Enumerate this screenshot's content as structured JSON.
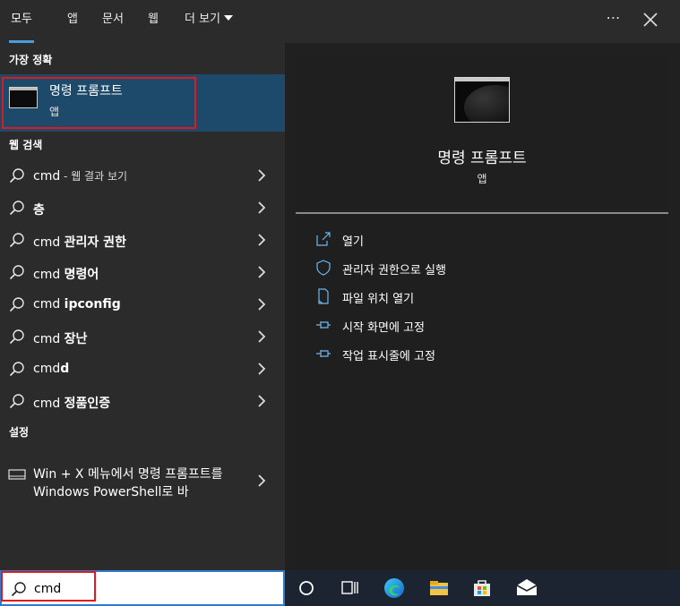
{
  "tabs": [
    {
      "label": "모두",
      "active": true
    },
    {
      "label": "앱"
    },
    {
      "label": "문서"
    },
    {
      "label": "웹"
    },
    {
      "label": "더 보기"
    }
  ],
  "window_controls": {
    "more": "⋯",
    "close_icon": "close-icon"
  },
  "left": {
    "best_match_header": "가장 정확",
    "best_match": {
      "title": "명령 프롬프트",
      "subtitle": "앱"
    },
    "web_header": "웹 검색",
    "web_results": [
      {
        "prefix": "cmd",
        "bold": "",
        "suffix": " - 웹 결과 보기"
      },
      {
        "prefix": "",
        "bold": "층",
        "suffix": ""
      },
      {
        "prefix": "cmd ",
        "bold": "관리자 권한",
        "suffix": ""
      },
      {
        "prefix": "cmd ",
        "bold": "명령어",
        "suffix": ""
      },
      {
        "prefix": "cmd ",
        "bold": "ipconfig",
        "suffix": ""
      },
      {
        "prefix": "cmd ",
        "bold": "장난",
        "suffix": ""
      },
      {
        "prefix": "cmd",
        "bold": "d",
        "suffix": ""
      },
      {
        "prefix": "cmd ",
        "bold": "정품인증",
        "suffix": ""
      }
    ],
    "settings_header": "설정",
    "setting_item": "Win + X 메뉴에서 명령 프롬프트를 Windows PowerShell로 바"
  },
  "right": {
    "title": "명령 프롬프트",
    "subtitle": "앱",
    "actions": [
      {
        "label": "열기",
        "icon": "open-icon"
      },
      {
        "label": "관리자 권한으로 실행",
        "icon": "shield-icon"
      },
      {
        "label": "파일 위치 열기",
        "icon": "file-location-icon"
      },
      {
        "label": "시작 화면에 고정",
        "icon": "pin-icon"
      },
      {
        "label": "작업 표시줄에 고정",
        "icon": "pin-icon"
      }
    ]
  },
  "search": {
    "value": "cmd"
  },
  "taskbar": {
    "icons": [
      "cortana-icon",
      "task-view-icon",
      "edge-icon",
      "file-explorer-icon",
      "store-icon",
      "mail-icon"
    ]
  },
  "colors": {
    "accent": "#4a9bdf",
    "highlight": "#1d4a6b",
    "annotation_red": "#e0191d",
    "taskbar": "#1b2430"
  }
}
